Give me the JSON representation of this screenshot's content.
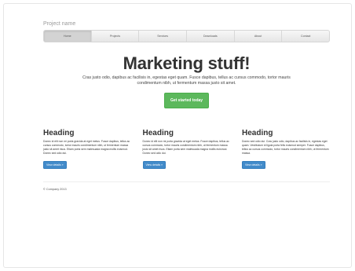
{
  "project_name": "Project name",
  "nav": {
    "items": [
      {
        "label": "Home",
        "active": true
      },
      {
        "label": "Projects",
        "active": false
      },
      {
        "label": "Services",
        "active": false
      },
      {
        "label": "Downloads",
        "active": false
      },
      {
        "label": "About",
        "active": false
      },
      {
        "label": "Contact",
        "active": false
      }
    ]
  },
  "hero": {
    "title": "Marketing stuff!",
    "lead": "Cras justo odio, dapibus ac facilisis in, egestas eget quam. Fusce dapibus, tellus ac cursus commodo, tortor mauris condimentum nibh, ut fermentum massa justo sit amet.",
    "cta_label": "Get started today"
  },
  "columns": [
    {
      "heading": "Heading",
      "body": "Donec id elit non mi porta gravida at eget metus. Fusce dapibus, tellus ac cursus commodo, tortor mauris condimentum nibh, ut fermentum massa justo sit amet risus. Etiam porta sem malesuada magna mollis euismod. Donec sed odio dui.",
      "button_label": "View details »"
    },
    {
      "heading": "Heading",
      "body": "Donec id elit non mi porta gravida at eget metus. Fusce dapibus, tellus ac cursus commodo, tortor mauris condimentum nibh, ut fermentum massa justo sit amet risus. Etiam porta sem malesuada magna mollis euismod. Donec sed odio dui.",
      "button_label": "View details »"
    },
    {
      "heading": "Heading",
      "body": "Donec sed odio dui. Cras justo odio, dapibus ac facilisis in, egestas eget quam. Vestibulum id ligula porta felis euismod semper. Fusce dapibus, tellus ac cursus commodo, tortor mauris condimentum nibh, ut fermentum massa.",
      "button_label": "View details »"
    }
  ],
  "footer": {
    "text": "© Company 2013"
  },
  "colors": {
    "success": "#5cb85c",
    "primary": "#428bca",
    "nav_active": "#d3d3d3"
  }
}
